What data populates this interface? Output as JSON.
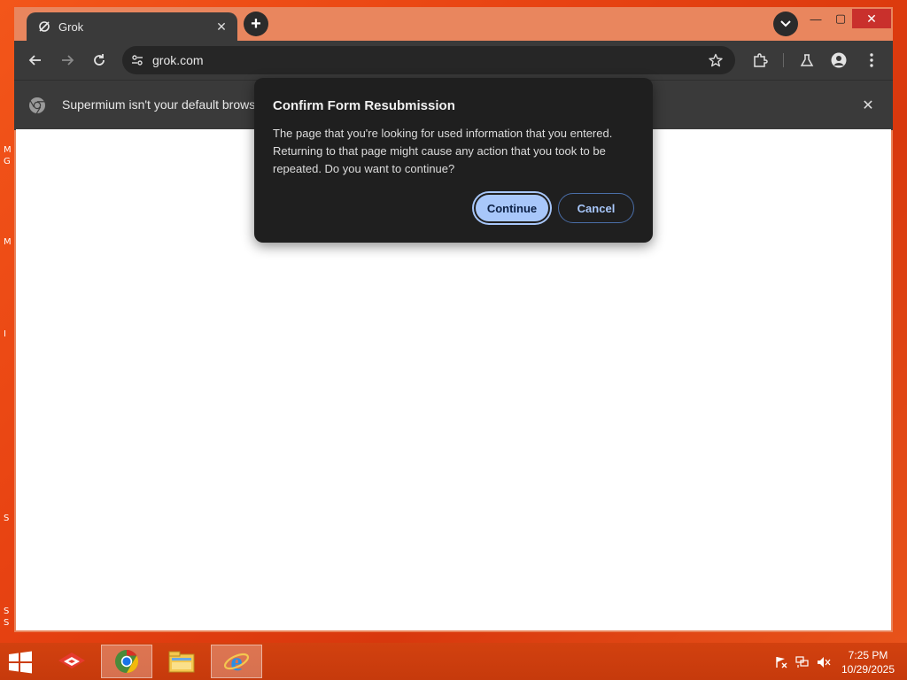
{
  "browser": {
    "tab": {
      "title": "Grok",
      "close_glyph": "✕"
    },
    "new_tab_glyph": "+",
    "tab_search_glyph": "⌄",
    "window_controls": {
      "minimize": "—",
      "maximize": "▢",
      "close": "✕"
    },
    "toolbar": {
      "url": "grok.com"
    },
    "infobar": {
      "text": "Supermium isn't your default browser",
      "close_glyph": "✕"
    }
  },
  "dialog": {
    "title": "Confirm Form Resubmission",
    "body": "The page that you're looking for used information that you entered. Returning to that page might cause any action that you took to be repeated. Do you want to continue?",
    "continue_label": "Continue",
    "cancel_label": "Cancel"
  },
  "desktop_fragments": [
    "M",
    "G",
    "M",
    "I",
    "S",
    "S",
    "S"
  ],
  "taskbar": {
    "pinned": [
      "app-icon",
      "chrome-icon",
      "file-explorer-icon",
      "internet-explorer-icon"
    ],
    "clock": {
      "time": "7:25 PM",
      "date": "10/29/2025"
    }
  },
  "colors": {
    "desktop": "#e84312",
    "titlebar": "#e9865e",
    "toolbar": "#3a3a3a",
    "dialog_bg": "#1f1f1f",
    "accent": "#a8c7fa",
    "taskbar": "#c63a0c"
  }
}
